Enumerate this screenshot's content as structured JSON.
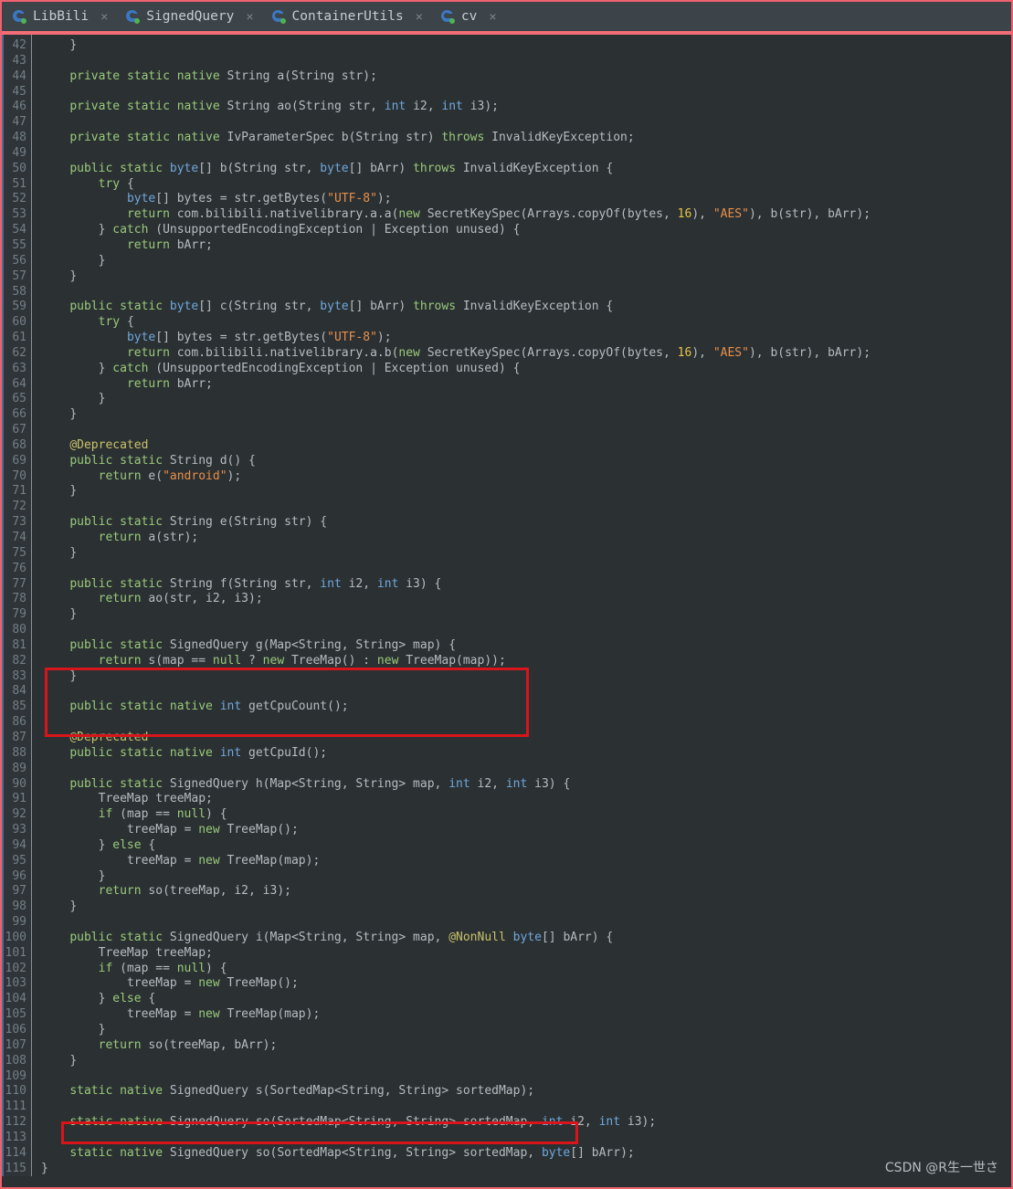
{
  "window": {
    "accent_color": "#f26d78",
    "editor_bg": "#2b3033",
    "gutter_bg": "#2e3438",
    "highlight_box_color": "#d8151b"
  },
  "tabs": [
    {
      "label": "LibBili",
      "icon": "java-class-icon",
      "close": "×",
      "active": true
    },
    {
      "label": "SignedQuery",
      "icon": "java-class-icon",
      "close": "×",
      "active": false
    },
    {
      "label": "ContainerUtils",
      "icon": "java-class-icon",
      "close": "×",
      "active": false
    },
    {
      "label": "cv",
      "icon": "java-class-icon",
      "close": "×",
      "active": false
    }
  ],
  "editor": {
    "first_line_number": 42,
    "last_line_number": 115,
    "lines": [
      {
        "n": 42,
        "text": "    }"
      },
      {
        "n": 43,
        "text": ""
      },
      {
        "n": 44,
        "text": "    private static native String a(String str);"
      },
      {
        "n": 45,
        "text": ""
      },
      {
        "n": 46,
        "text": "    private static native String ao(String str, int i2, int i3);"
      },
      {
        "n": 47,
        "text": ""
      },
      {
        "n": 48,
        "text": "    private static native IvParameterSpec b(String str) throws InvalidKeyException;"
      },
      {
        "n": 49,
        "text": ""
      },
      {
        "n": 50,
        "text": "    public static byte[] b(String str, byte[] bArr) throws InvalidKeyException {"
      },
      {
        "n": 51,
        "text": "        try {"
      },
      {
        "n": 52,
        "text": "            byte[] bytes = str.getBytes(\"UTF-8\");"
      },
      {
        "n": 53,
        "text": "            return com.bilibili.nativelibrary.a.a(new SecretKeySpec(Arrays.copyOf(bytes, 16), \"AES\"), b(str), bArr);"
      },
      {
        "n": 54,
        "text": "        } catch (UnsupportedEncodingException | Exception unused) {"
      },
      {
        "n": 55,
        "text": "            return bArr;"
      },
      {
        "n": 56,
        "text": "        }"
      },
      {
        "n": 57,
        "text": "    }"
      },
      {
        "n": 58,
        "text": ""
      },
      {
        "n": 59,
        "text": "    public static byte[] c(String str, byte[] bArr) throws InvalidKeyException {"
      },
      {
        "n": 60,
        "text": "        try {"
      },
      {
        "n": 61,
        "text": "            byte[] bytes = str.getBytes(\"UTF-8\");"
      },
      {
        "n": 62,
        "text": "            return com.bilibili.nativelibrary.a.b(new SecretKeySpec(Arrays.copyOf(bytes, 16), \"AES\"), b(str), bArr);"
      },
      {
        "n": 63,
        "text": "        } catch (UnsupportedEncodingException | Exception unused) {"
      },
      {
        "n": 64,
        "text": "            return bArr;"
      },
      {
        "n": 65,
        "text": "        }"
      },
      {
        "n": 66,
        "text": "    }"
      },
      {
        "n": 67,
        "text": ""
      },
      {
        "n": 68,
        "text": "    @Deprecated"
      },
      {
        "n": 69,
        "text": "    public static String d() {"
      },
      {
        "n": 70,
        "text": "        return e(\"android\");"
      },
      {
        "n": 71,
        "text": "    }"
      },
      {
        "n": 72,
        "text": ""
      },
      {
        "n": 73,
        "text": "    public static String e(String str) {"
      },
      {
        "n": 74,
        "text": "        return a(str);"
      },
      {
        "n": 75,
        "text": "    }"
      },
      {
        "n": 76,
        "text": ""
      },
      {
        "n": 77,
        "text": "    public static String f(String str, int i2, int i3) {"
      },
      {
        "n": 78,
        "text": "        return ao(str, i2, i3);"
      },
      {
        "n": 79,
        "text": "    }"
      },
      {
        "n": 80,
        "text": ""
      },
      {
        "n": 81,
        "text": "    public static SignedQuery g(Map<String, String> map) {"
      },
      {
        "n": 82,
        "text": "        return s(map == null ? new TreeMap() : new TreeMap(map));"
      },
      {
        "n": 83,
        "text": "    }"
      },
      {
        "n": 84,
        "text": ""
      },
      {
        "n": 85,
        "text": "    public static native int getCpuCount();"
      },
      {
        "n": 86,
        "text": ""
      },
      {
        "n": 87,
        "text": "    @Deprecated"
      },
      {
        "n": 88,
        "text": "    public static native int getCpuId();"
      },
      {
        "n": 89,
        "text": ""
      },
      {
        "n": 90,
        "text": "    public static SignedQuery h(Map<String, String> map, int i2, int i3) {"
      },
      {
        "n": 91,
        "text": "        TreeMap treeMap;"
      },
      {
        "n": 92,
        "text": "        if (map == null) {"
      },
      {
        "n": 93,
        "text": "            treeMap = new TreeMap();"
      },
      {
        "n": 94,
        "text": "        } else {"
      },
      {
        "n": 95,
        "text": "            treeMap = new TreeMap(map);"
      },
      {
        "n": 96,
        "text": "        }"
      },
      {
        "n": 97,
        "text": "        return so(treeMap, i2, i3);"
      },
      {
        "n": 98,
        "text": "    }"
      },
      {
        "n": 99,
        "text": ""
      },
      {
        "n": 100,
        "text": "    public static SignedQuery i(Map<String, String> map, @NonNull byte[] bArr) {"
      },
      {
        "n": 101,
        "text": "        TreeMap treeMap;"
      },
      {
        "n": 102,
        "text": "        if (map == null) {"
      },
      {
        "n": 103,
        "text": "            treeMap = new TreeMap();"
      },
      {
        "n": 104,
        "text": "        } else {"
      },
      {
        "n": 105,
        "text": "            treeMap = new TreeMap(map);"
      },
      {
        "n": 106,
        "text": "        }"
      },
      {
        "n": 107,
        "text": "        return so(treeMap, bArr);"
      },
      {
        "n": 108,
        "text": "    }"
      },
      {
        "n": 109,
        "text": ""
      },
      {
        "n": 110,
        "text": "    static native SignedQuery s(SortedMap<String, String> sortedMap);"
      },
      {
        "n": 111,
        "text": ""
      },
      {
        "n": 112,
        "text": "    static native SignedQuery so(SortedMap<String, String> sortedMap, int i2, int i3);"
      },
      {
        "n": 113,
        "text": ""
      },
      {
        "n": 114,
        "text": "    static native SignedQuery so(SortedMap<String, String> sortedMap, byte[] bArr);"
      },
      {
        "n": 115,
        "text": "}"
      }
    ],
    "highlight_boxes": [
      {
        "name": "g-method-highlight",
        "lines": "81-84"
      },
      {
        "name": "s-declaration-highlight",
        "lines": "110"
      }
    ]
  },
  "watermark": {
    "text": "CSDN @R生一世さ"
  },
  "syntax_colors": {
    "keyword": "#9aca7a",
    "type": "#b6bcc0",
    "primitive": "#6fa8dc",
    "string": "#e8904a",
    "number": "#e6c645",
    "annotation": "#c9c26a",
    "line_number": "#757f87"
  }
}
